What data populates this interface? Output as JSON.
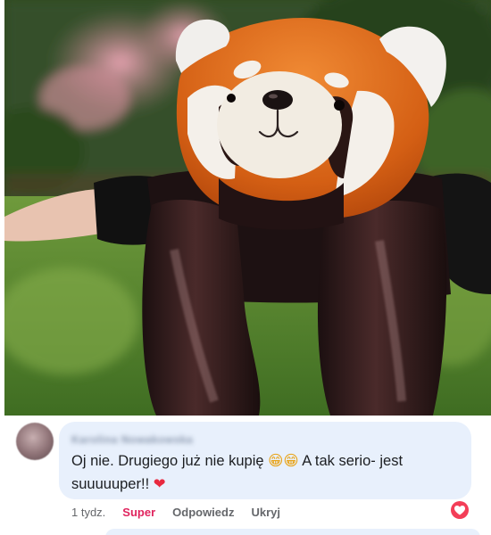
{
  "photo": {
    "subject_icon": "red-panda-plush-photo"
  },
  "comment": {
    "author_name": "Karolina Nowakowska",
    "text_main": "Oj nie. Drugiego już nie kupię",
    "emoji_grin": "😁",
    "text_after_emoji": "A tak serio- jest suuuuuper!!",
    "emoji_heart": "❤",
    "timestamp": "1 tydz.",
    "like_label": "Super",
    "reply_label": "Odpowiedz",
    "hide_label": "Ukryj",
    "reaction_icon": "heart-reaction-icon",
    "colors": {
      "bubble": "#e8f0fc",
      "like_active": "#e0245e",
      "reaction": "#f33e58"
    }
  }
}
